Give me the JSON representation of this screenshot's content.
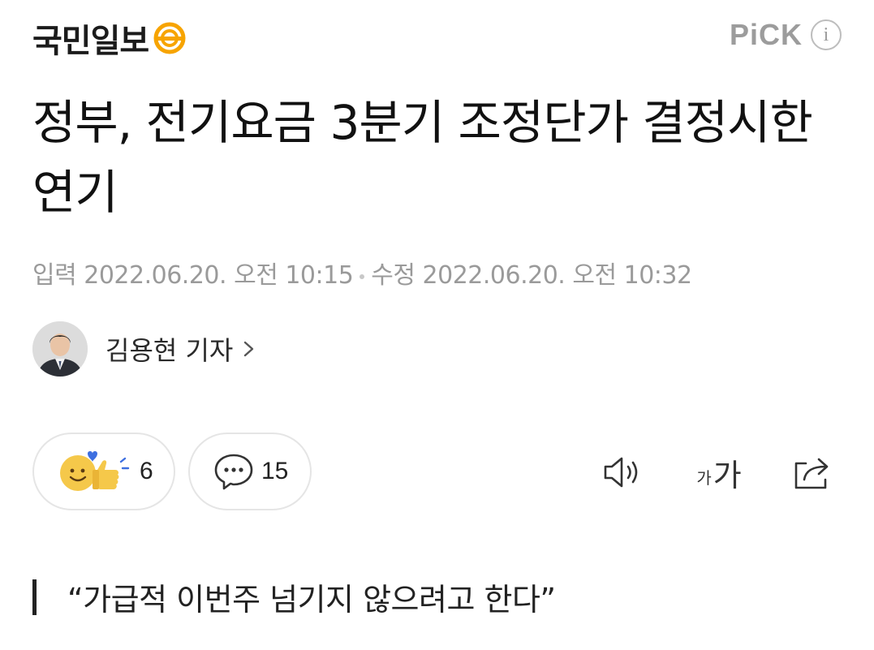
{
  "header": {
    "logo_text": "국민일보",
    "logo_mark_color": "#f7a400",
    "pick_label": "PiCK",
    "info_icon": "i"
  },
  "article": {
    "title": "정부, 전기요금 3분기 조정단가 결정시한 연기",
    "dates": {
      "published_label": "입력",
      "published_value": "2022.06.20. 오전 10:15",
      "modified_label": "수정",
      "modified_value": "2022.06.20. 오전 10:32"
    },
    "reporter": {
      "name": "김용현 기자"
    },
    "reactions": {
      "count": "6",
      "icon": "smile-and-thumbs-up-icon"
    },
    "comments": {
      "count": "15",
      "icon": "comment-bubble-icon"
    },
    "tools": {
      "speaker_icon": "speaker-icon",
      "font_small": "가",
      "font_large": "가",
      "share_icon": "share-icon"
    },
    "subheading": "“가급적 이번주 넘기지 않으려고 한다”"
  },
  "colors": {
    "accent": "#f7a400",
    "muted_text": "#9a9a9a",
    "border": "#e5e5e5",
    "reaction_yellow": "#f5c84a",
    "reaction_heart": "#3d6fe0"
  }
}
